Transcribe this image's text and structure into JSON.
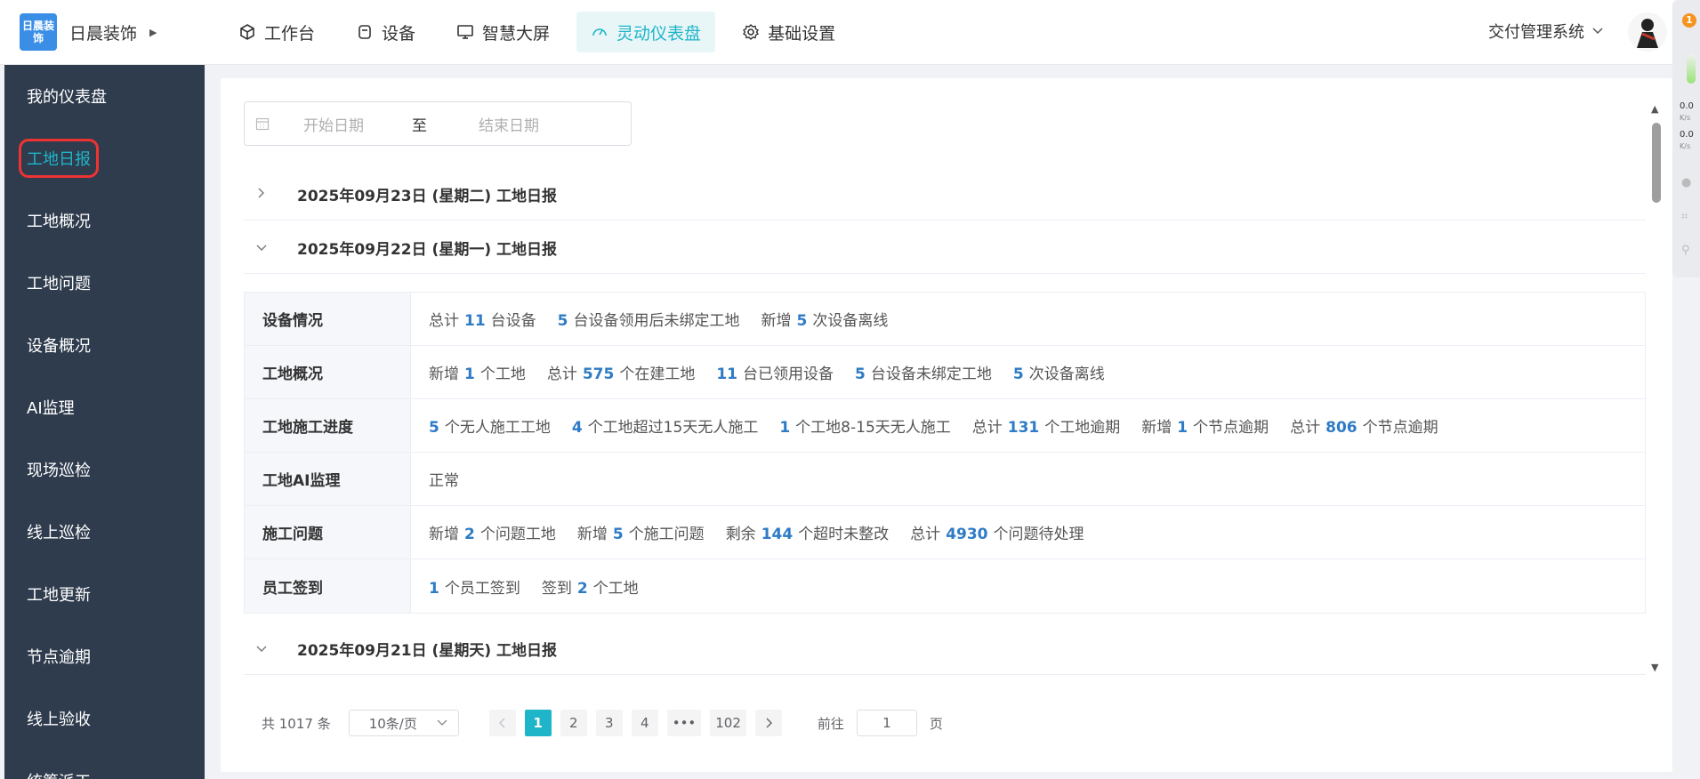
{
  "brand": {
    "logo_text": "日晨装饰",
    "name": "日晨装饰"
  },
  "nav": [
    {
      "label": "工作台",
      "icon": "cube-icon"
    },
    {
      "label": "设备",
      "icon": "device-icon"
    },
    {
      "label": "智慧大屏",
      "icon": "monitor-icon"
    },
    {
      "label": "灵动仪表盘",
      "icon": "dashboard-icon",
      "active": true
    },
    {
      "label": "基础设置",
      "icon": "gear-icon"
    }
  ],
  "system_select": "交付管理系统",
  "sidebar": {
    "items": [
      {
        "label": "我的仪表盘"
      },
      {
        "label": "工地日报",
        "active": true
      },
      {
        "label": "工地概况"
      },
      {
        "label": "工地问题"
      },
      {
        "label": "设备概况"
      },
      {
        "label": "AI监理"
      },
      {
        "label": "现场巡检"
      },
      {
        "label": "线上巡检"
      },
      {
        "label": "工地更新"
      },
      {
        "label": "节点逾期"
      },
      {
        "label": "线上验收"
      },
      {
        "label": "统筹派工"
      }
    ]
  },
  "date_range": {
    "start_placeholder": "开始日期",
    "separator": "至",
    "end_placeholder": "结束日期"
  },
  "reports": [
    {
      "title": "2025年09月23日 (星期二) 工地日报",
      "expanded": false
    },
    {
      "title": "2025年09月22日 (星期一) 工地日报",
      "expanded": true
    },
    {
      "title": "2025年09月21日 (星期天) 工地日报",
      "expanded": true
    }
  ],
  "detail": {
    "rows": [
      {
        "label": "设备情况",
        "segments": [
          {
            "pre": "总计",
            "num": "11",
            "post": "台设备"
          },
          {
            "pre": "",
            "num": "5",
            "post": "台设备领用后未绑定工地"
          },
          {
            "pre": "新增",
            "num": "5",
            "post": "次设备离线"
          }
        ]
      },
      {
        "label": "工地概况",
        "segments": [
          {
            "pre": "新增",
            "num": "1",
            "post": "个工地"
          },
          {
            "pre": "总计",
            "num": "575",
            "post": "个在建工地"
          },
          {
            "pre": "",
            "num": "11",
            "post": "台已领用设备"
          },
          {
            "pre": "",
            "num": "5",
            "post": "台设备未绑定工地"
          },
          {
            "pre": "",
            "num": "5",
            "post": "次设备离线"
          }
        ]
      },
      {
        "label": "工地施工进度",
        "segments": [
          {
            "pre": "",
            "num": "5",
            "post": "个无人施工工地"
          },
          {
            "pre": "",
            "num": "4",
            "post": "个工地超过15天无人施工"
          },
          {
            "pre": "",
            "num": "1",
            "post": "个工地8-15天无人施工"
          },
          {
            "pre": "总计",
            "num": "131",
            "post": "个工地逾期"
          },
          {
            "pre": "新增",
            "num": "1",
            "post": "个节点逾期"
          },
          {
            "pre": "总计",
            "num": "806",
            "post": "个节点逾期"
          }
        ]
      },
      {
        "label": "工地AI监理",
        "segments": [
          {
            "pre": "正常",
            "num": "",
            "post": ""
          }
        ]
      },
      {
        "label": "施工问题",
        "segments": [
          {
            "pre": "新增",
            "num": "2",
            "post": "个问题工地"
          },
          {
            "pre": "新增",
            "num": "5",
            "post": "个施工问题"
          },
          {
            "pre": "剩余",
            "num": "144",
            "post": "个超时未整改"
          },
          {
            "pre": "总计",
            "num": "4930",
            "post": "个问题待处理"
          }
        ]
      },
      {
        "label": "员工签到",
        "segments": [
          {
            "pre": "",
            "num": "1",
            "post": "个员工签到"
          },
          {
            "pre": "签到",
            "num": "2",
            "post": "个工地"
          }
        ]
      }
    ]
  },
  "pagination": {
    "total": "共 1017 条",
    "page_size": "10条/页",
    "pages": [
      "1",
      "2",
      "3",
      "4",
      "•••",
      "102"
    ],
    "current": "1",
    "goto_label": "前往",
    "goto_value": "1",
    "goto_suffix": "页"
  },
  "widget": {
    "badge": "1",
    "up": "0.0",
    "up_unit": "K/s",
    "down": "0.0",
    "down_unit": "K/s"
  },
  "colors": {
    "accent": "#1fb5c9",
    "number": "#2e7bc6",
    "sidebar_bg": "#2f3c4e",
    "highlight_border": "#e33333"
  }
}
